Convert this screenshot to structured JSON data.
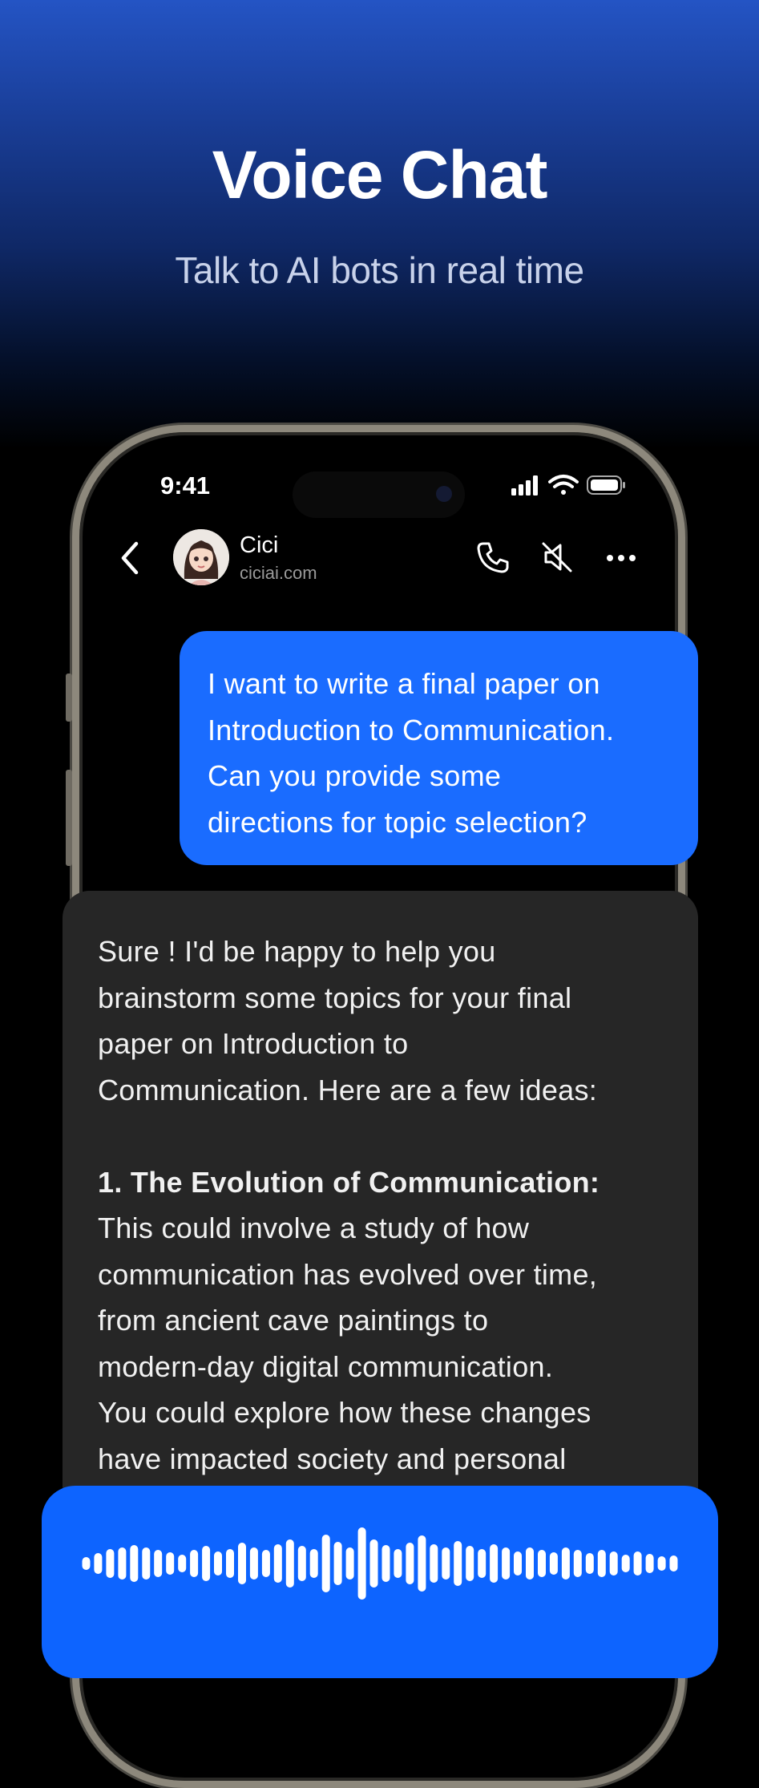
{
  "hero": {
    "title": "Voice Chat",
    "subtitle": "Talk to AI bots in real time"
  },
  "status_bar": {
    "time": "9:41",
    "icons": [
      "cellular-signal-icon",
      "wifi-icon",
      "battery-icon"
    ]
  },
  "chat_header": {
    "bot_name": "Cici",
    "bot_site": "ciciai.com",
    "actions": [
      "phone-icon",
      "mute-speaker-icon",
      "more-options-icon"
    ]
  },
  "messages": {
    "user": {
      "lines": [
        "I want to write a final paper on",
        "Introduction to Communication.",
        "Can you provide some",
        "directions for topic selection?"
      ]
    },
    "bot": {
      "intro_lines": [
        "Sure ! I'd be happy to help you",
        "brainstorm some topics for your final",
        "paper on Introduction to",
        "Communication. Here are a few ideas:"
      ],
      "point_heading": "1. The Evolution of Communication:",
      "point_lines": [
        "This could involve a study of how",
        "communication has evolved over time,",
        "from ancient cave paintings to",
        "modern-day digital communication.",
        "You could explore how these changes",
        "have impacted society and personal"
      ]
    }
  },
  "voice_input": {
    "state_icon": "audio-waveform-icon",
    "accent": "#0d64ff"
  },
  "colors": {
    "user_bubble": "#1a6cff",
    "bot_bubble": "#262626",
    "background": "#000000"
  }
}
